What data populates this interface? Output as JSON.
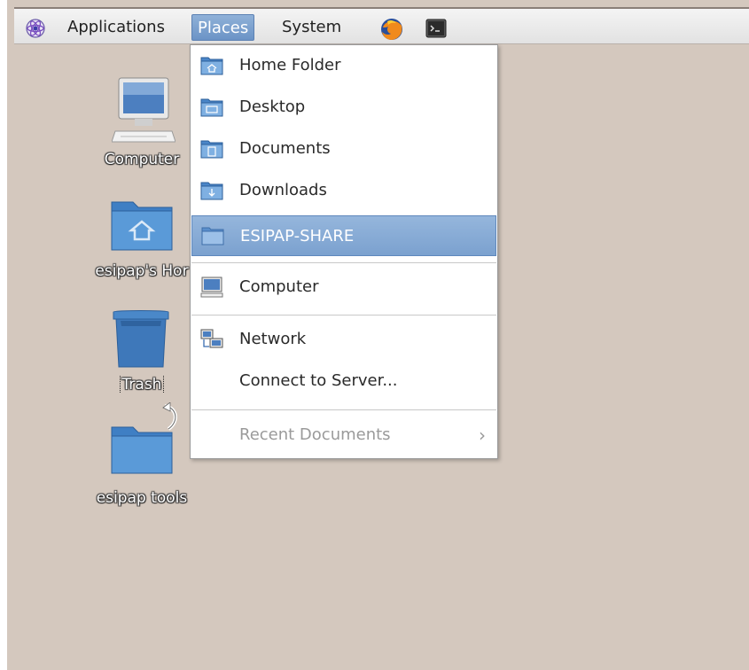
{
  "panel": {
    "applications": "Applications",
    "places": "Places",
    "system": "System"
  },
  "desktop": {
    "icons": [
      {
        "label": "Computer",
        "icon": "computer-icon"
      },
      {
        "label": "esipap's Hor",
        "icon": "home-folder-icon"
      },
      {
        "label": "Trash",
        "icon": "trash-icon"
      },
      {
        "label": "esipap tools",
        "icon": "folder-icon"
      }
    ]
  },
  "places_menu": {
    "items": [
      {
        "label": "Home Folder",
        "icon": "home-folder-icon"
      },
      {
        "label": "Desktop",
        "icon": "desktop-folder-icon"
      },
      {
        "label": "Documents",
        "icon": "documents-folder-icon"
      },
      {
        "label": "Downloads",
        "icon": "downloads-folder-icon"
      },
      {
        "label": "ESIPAP-SHARE",
        "icon": "folder-icon",
        "highlighted": true
      },
      {
        "label": "Computer",
        "icon": "computer-icon"
      },
      {
        "label": "Network",
        "icon": "network-icon"
      },
      {
        "label": "Connect to Server...",
        "icon": ""
      },
      {
        "label": "Recent Documents",
        "icon": "",
        "disabled": true
      }
    ]
  },
  "colors": {
    "desktop_bg": "#d4c8be",
    "highlight": "#7ba1cf",
    "folder_blue": "#4a86c8"
  }
}
